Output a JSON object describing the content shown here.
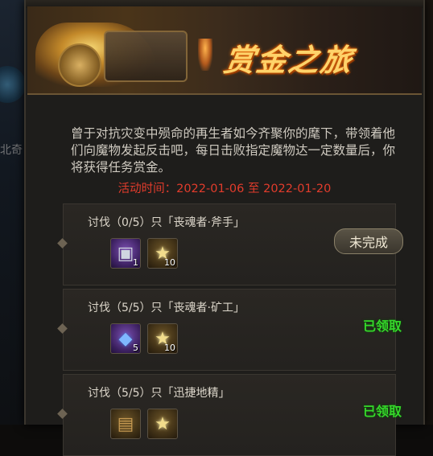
{
  "background": {
    "side_text": "北奇"
  },
  "banner": {
    "title": "赏金之旅"
  },
  "intro": {
    "description": "曾于对抗灾变中殒命的再生者如今齐聚你的麾下，带领着他们向魔物发起反击吧，每日击败指定魔物达一定数量后，你将获得任务赏金。",
    "time_label": "活动时间：",
    "time_range": "2022-01-06 至 2022-01-20"
  },
  "tasks": [
    {
      "title": "讨伐（0/5）只「丧魂者·斧手」",
      "rewards": [
        {
          "icon": "treasure-box-icon",
          "qty": "1",
          "rarity": "purple"
        },
        {
          "icon": "star-icon",
          "qty": "10",
          "rarity": "gold"
        }
      ],
      "status": "未完成",
      "completed": false
    },
    {
      "title": "讨伐（5/5）只「丧魂者·矿工」",
      "rewards": [
        {
          "icon": "crystal-icon",
          "qty": "5",
          "rarity": "purple"
        },
        {
          "icon": "star-icon",
          "qty": "10",
          "rarity": "gold"
        }
      ],
      "status": "已领取",
      "completed": true
    },
    {
      "title": "讨伐（5/5）只「迅捷地精」",
      "rewards": [
        {
          "icon": "scroll-icon",
          "qty": "",
          "rarity": "gold"
        },
        {
          "icon": "star-icon",
          "qty": "",
          "rarity": "gold"
        }
      ],
      "status": "已领取",
      "completed": true
    }
  ],
  "colors": {
    "title_gold": "#ffd36a",
    "time_red": "#e23c2c",
    "done_green": "#35d82a"
  }
}
